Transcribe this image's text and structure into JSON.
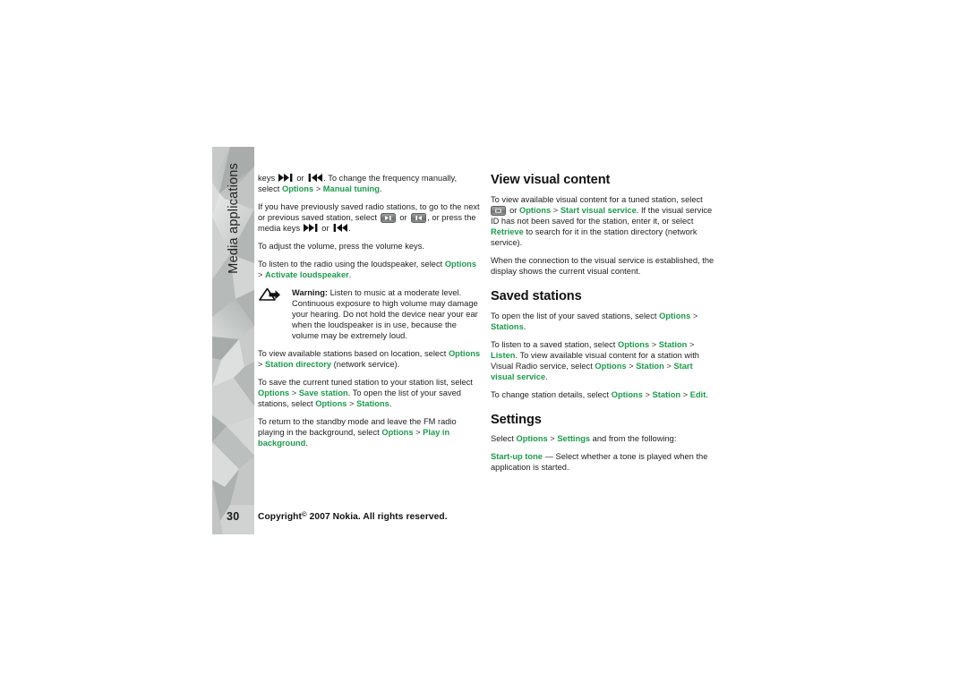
{
  "document": {
    "page_number": "30",
    "side_tab_label": "Media applications",
    "footer": {
      "copyright_prefix": "Copyright",
      "copyright_symbol": "©",
      "copyright_rest": "2007 Nokia. All rights reserved."
    },
    "accent_green": "#1d9b4b",
    "side_tab_gray": "#b9bcbb"
  },
  "left_column": {
    "para_1": {
      "t1": "keys ",
      "icon_next": "media-key-next-icon",
      "t2": " or ",
      "icon_prev": "media-key-previous-icon",
      "t3": ". To change the frequency manually, select ",
      "g1": "Options",
      "sep1": " > ",
      "g2": "Manual tuning",
      "t4": "."
    },
    "para_2": {
      "t1": "If you have previously saved radio stations, to go to the next or previous saved station, select ",
      "key_next": "softkey-next-station",
      "t2": " or ",
      "key_prev": "softkey-previous-station",
      "t3": ", or press the media keys ",
      "icon_next": "media-key-next-icon",
      "t4": " or ",
      "icon_prev": "media-key-previous-icon",
      "t5": "."
    },
    "para_3": "To adjust the volume, press the volume keys.",
    "para_4": {
      "t1": "To listen to the radio using the loudspeaker, select ",
      "g1": "Options",
      "sep1": " > ",
      "g2": "Activate loudspeaker",
      "t2": "."
    },
    "warning": {
      "icon": "warning-triangle-icon",
      "label": "Warning:",
      "text": " Listen to music at a moderate level. Continuous exposure to high volume may damage your hearing. Do not hold the device near your ear when the loudspeaker is in use, because the volume may be extremely loud."
    },
    "para_5": {
      "t1": "To view available stations based on location, select ",
      "g1": "Options",
      "sep1": " > ",
      "g2": "Station directory",
      "t2": " (network service)."
    },
    "para_6": {
      "t1": "To save the current tuned station to your station list, select ",
      "g1": "Options",
      "sep1": " > ",
      "g2": "Save station",
      "t2": ". To open the list of your saved stations, select ",
      "g3": "Options",
      "sep2": " > ",
      "g4": "Stations",
      "t3": "."
    },
    "para_7": {
      "t1": "To return to the standby mode and leave the FM radio playing in the background, select ",
      "g1": "Options",
      "sep1": " > ",
      "g2": "Play in background",
      "t2": "."
    }
  },
  "right_column": {
    "heading_1": "View visual content",
    "para_1": {
      "t1": "To view available visual content for a tuned station, select ",
      "key_visual": "softkey-visual-service",
      "t2": " or ",
      "g1": "Options",
      "sep1": " > ",
      "g2": "Start visual service",
      "t3": ". If the visual service ID has not been saved for the station, enter it, or select ",
      "g3": "Retrieve",
      "t4": " to search for it in the station directory (network service)."
    },
    "para_2": "When the connection to the visual service is established, the display shows the current visual content.",
    "heading_2": "Saved stations",
    "para_3": {
      "t1": "To open the list of your saved stations, select ",
      "g1": "Options",
      "sep1": " > ",
      "g2": "Stations",
      "t2": "."
    },
    "para_4": {
      "t1": "To listen to a saved station, select ",
      "g1": "Options",
      "sep1": " > ",
      "g2": "Station",
      "sep2": " > ",
      "g3": "Listen",
      "t2": ". To view available visual content for a station with Visual Radio service, select ",
      "g4": "Options",
      "sep3": " > ",
      "g5": "Station",
      "sep4": " > ",
      "g6": "Start visual service",
      "t3": "."
    },
    "para_5": {
      "t1": "To change station details, select ",
      "g1": "Options",
      "sep1": " > ",
      "g2": "Station",
      "sep2": " > ",
      "g3": "Edit",
      "t2": "."
    },
    "heading_3": "Settings",
    "para_6": {
      "t1": "Select ",
      "g1": "Options",
      "sep1": " > ",
      "g2": "Settings",
      "t2": " and from the following:"
    },
    "para_7": {
      "g1": "Start-up tone",
      "t1": " — Select whether a tone is played when the application is started."
    }
  }
}
